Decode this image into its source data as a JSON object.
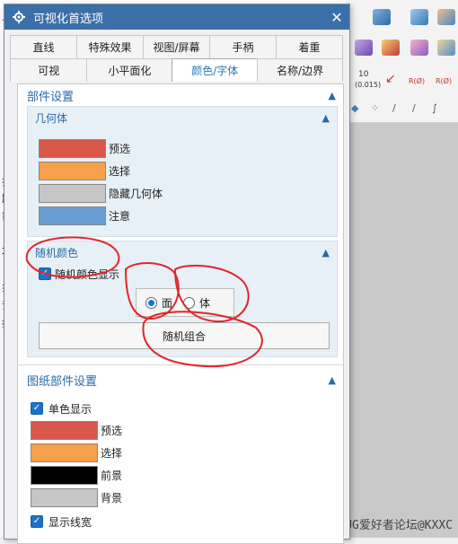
{
  "dialog": {
    "title": "可视化首选项",
    "close_label": "✕",
    "gear_icon": "gear-icon"
  },
  "tabs": {
    "row1": [
      "直线",
      "特殊效果",
      "视图/屏幕",
      "手柄",
      "着重"
    ],
    "row2": [
      "可视",
      "小平面化",
      "颜色/字体",
      "名称/边界"
    ],
    "active": "颜色/字体"
  },
  "part_settings": {
    "title": "部件设置",
    "geometry": {
      "title": "几何体",
      "colors": [
        {
          "label": "预选",
          "color": "#d9574b"
        },
        {
          "label": "选择",
          "color": "#f5a04a"
        },
        {
          "label": "隐藏几何体",
          "color": "#c6c6c6"
        },
        {
          "label": "注意",
          "color": "#6a9ed2"
        }
      ]
    },
    "random_color": {
      "title": "随机颜色",
      "show_checkbox_label": "随机颜色显示",
      "show_checked": true,
      "radio_face": "面",
      "radio_body": "体",
      "radio_selected": "面",
      "combine_button": "随机组合"
    }
  },
  "drawing_settings": {
    "title": "图纸部件设置",
    "mono_label": "单色显示",
    "mono_checked": true,
    "colors": [
      {
        "label": "预选",
        "color": "#d9574b"
      },
      {
        "label": "选择",
        "color": "#f5a04a"
      },
      {
        "label": "前景",
        "color": "#000000"
      },
      {
        "label": "背景",
        "color": "#c6c6c6"
      }
    ],
    "linewidth_label": "显示线宽",
    "linewidth_checked": true
  },
  "background": {
    "toolbar_label_1": "10",
    "toolbar_label_2": "(0.015)",
    "toolbar_label_3": "R(Ø)",
    "watermark": "UG爱好者论坛@KXXC",
    "left_glyphs": [
      "义",
      "扫",
      "跟",
      "象",
      "巧",
      "彳",
      "扌",
      "诏",
      "拔"
    ]
  },
  "colors": {
    "title_bar": "#3b6fa8",
    "accent": "#2a7ab5",
    "annotation_red": "#e0262a"
  }
}
